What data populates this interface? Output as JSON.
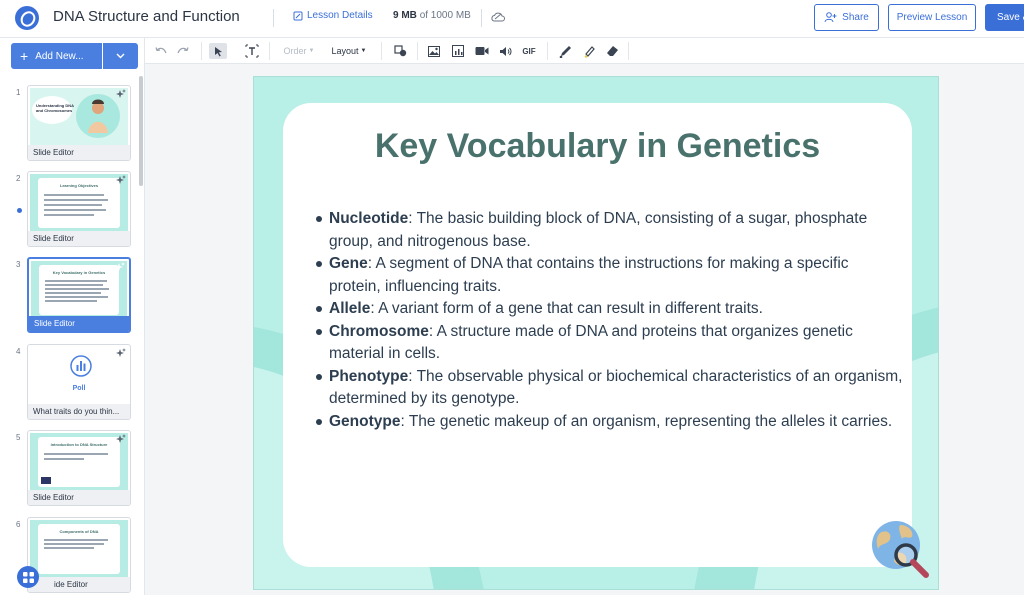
{
  "header": {
    "title": "DNA Structure and Function",
    "lesson_details": "Lesson Details",
    "storage_used": "9 MB",
    "storage_total": "of 1000 MB",
    "share": "Share",
    "preview": "Preview Lesson",
    "save": "Save &"
  },
  "sidebar": {
    "add_new": "Add New...",
    "slides": [
      {
        "num": "1",
        "title": "Understanding DNA and Chromosomes",
        "footer": "Slide Editor"
      },
      {
        "num": "2",
        "title": "Learning Objectives",
        "footer": "Slide Editor"
      },
      {
        "num": "3",
        "title": "Key Vocabulary in Genetics",
        "footer": "Slide Editor"
      },
      {
        "num": "4",
        "title": "Poll",
        "footer": "What traits do you thin..."
      },
      {
        "num": "5",
        "title": "Introduction to DNA Structure",
        "footer": "Slide Editor"
      },
      {
        "num": "6",
        "title": "Components of DNA",
        "footer": "Slide Editor"
      }
    ],
    "last_footer_partial": "ide Editor"
  },
  "toolbar": {
    "order": "Order",
    "layout": "Layout",
    "gif": "GIF"
  },
  "slide": {
    "heading": "Key Vocabulary in Genetics",
    "items": [
      {
        "term": "Nucleotide",
        "definition": ": The basic building block of DNA, consisting of a sugar, phosphate group, and nitrogenous base."
      },
      {
        "term": "Gene",
        "definition": ": A segment of DNA that contains the instructions for making a specific protein, influencing traits."
      },
      {
        "term": "Allele",
        "definition": ": A variant form of a gene that can result in different traits."
      },
      {
        "term": "Chromosome",
        "definition": ": A structure made of DNA and proteins that organizes genetic material in cells."
      },
      {
        "term": "Phenotype",
        "definition": ": The observable physical or biochemical characteristics of an organism, determined by its genotype."
      },
      {
        "term": "Genotype",
        "definition": ": The genetic makeup of an organism, representing the alleles it carries."
      }
    ]
  },
  "colors": {
    "accent": "#3b6fd8",
    "slide_bg": "#b8efe6",
    "heading": "#4a726d"
  }
}
